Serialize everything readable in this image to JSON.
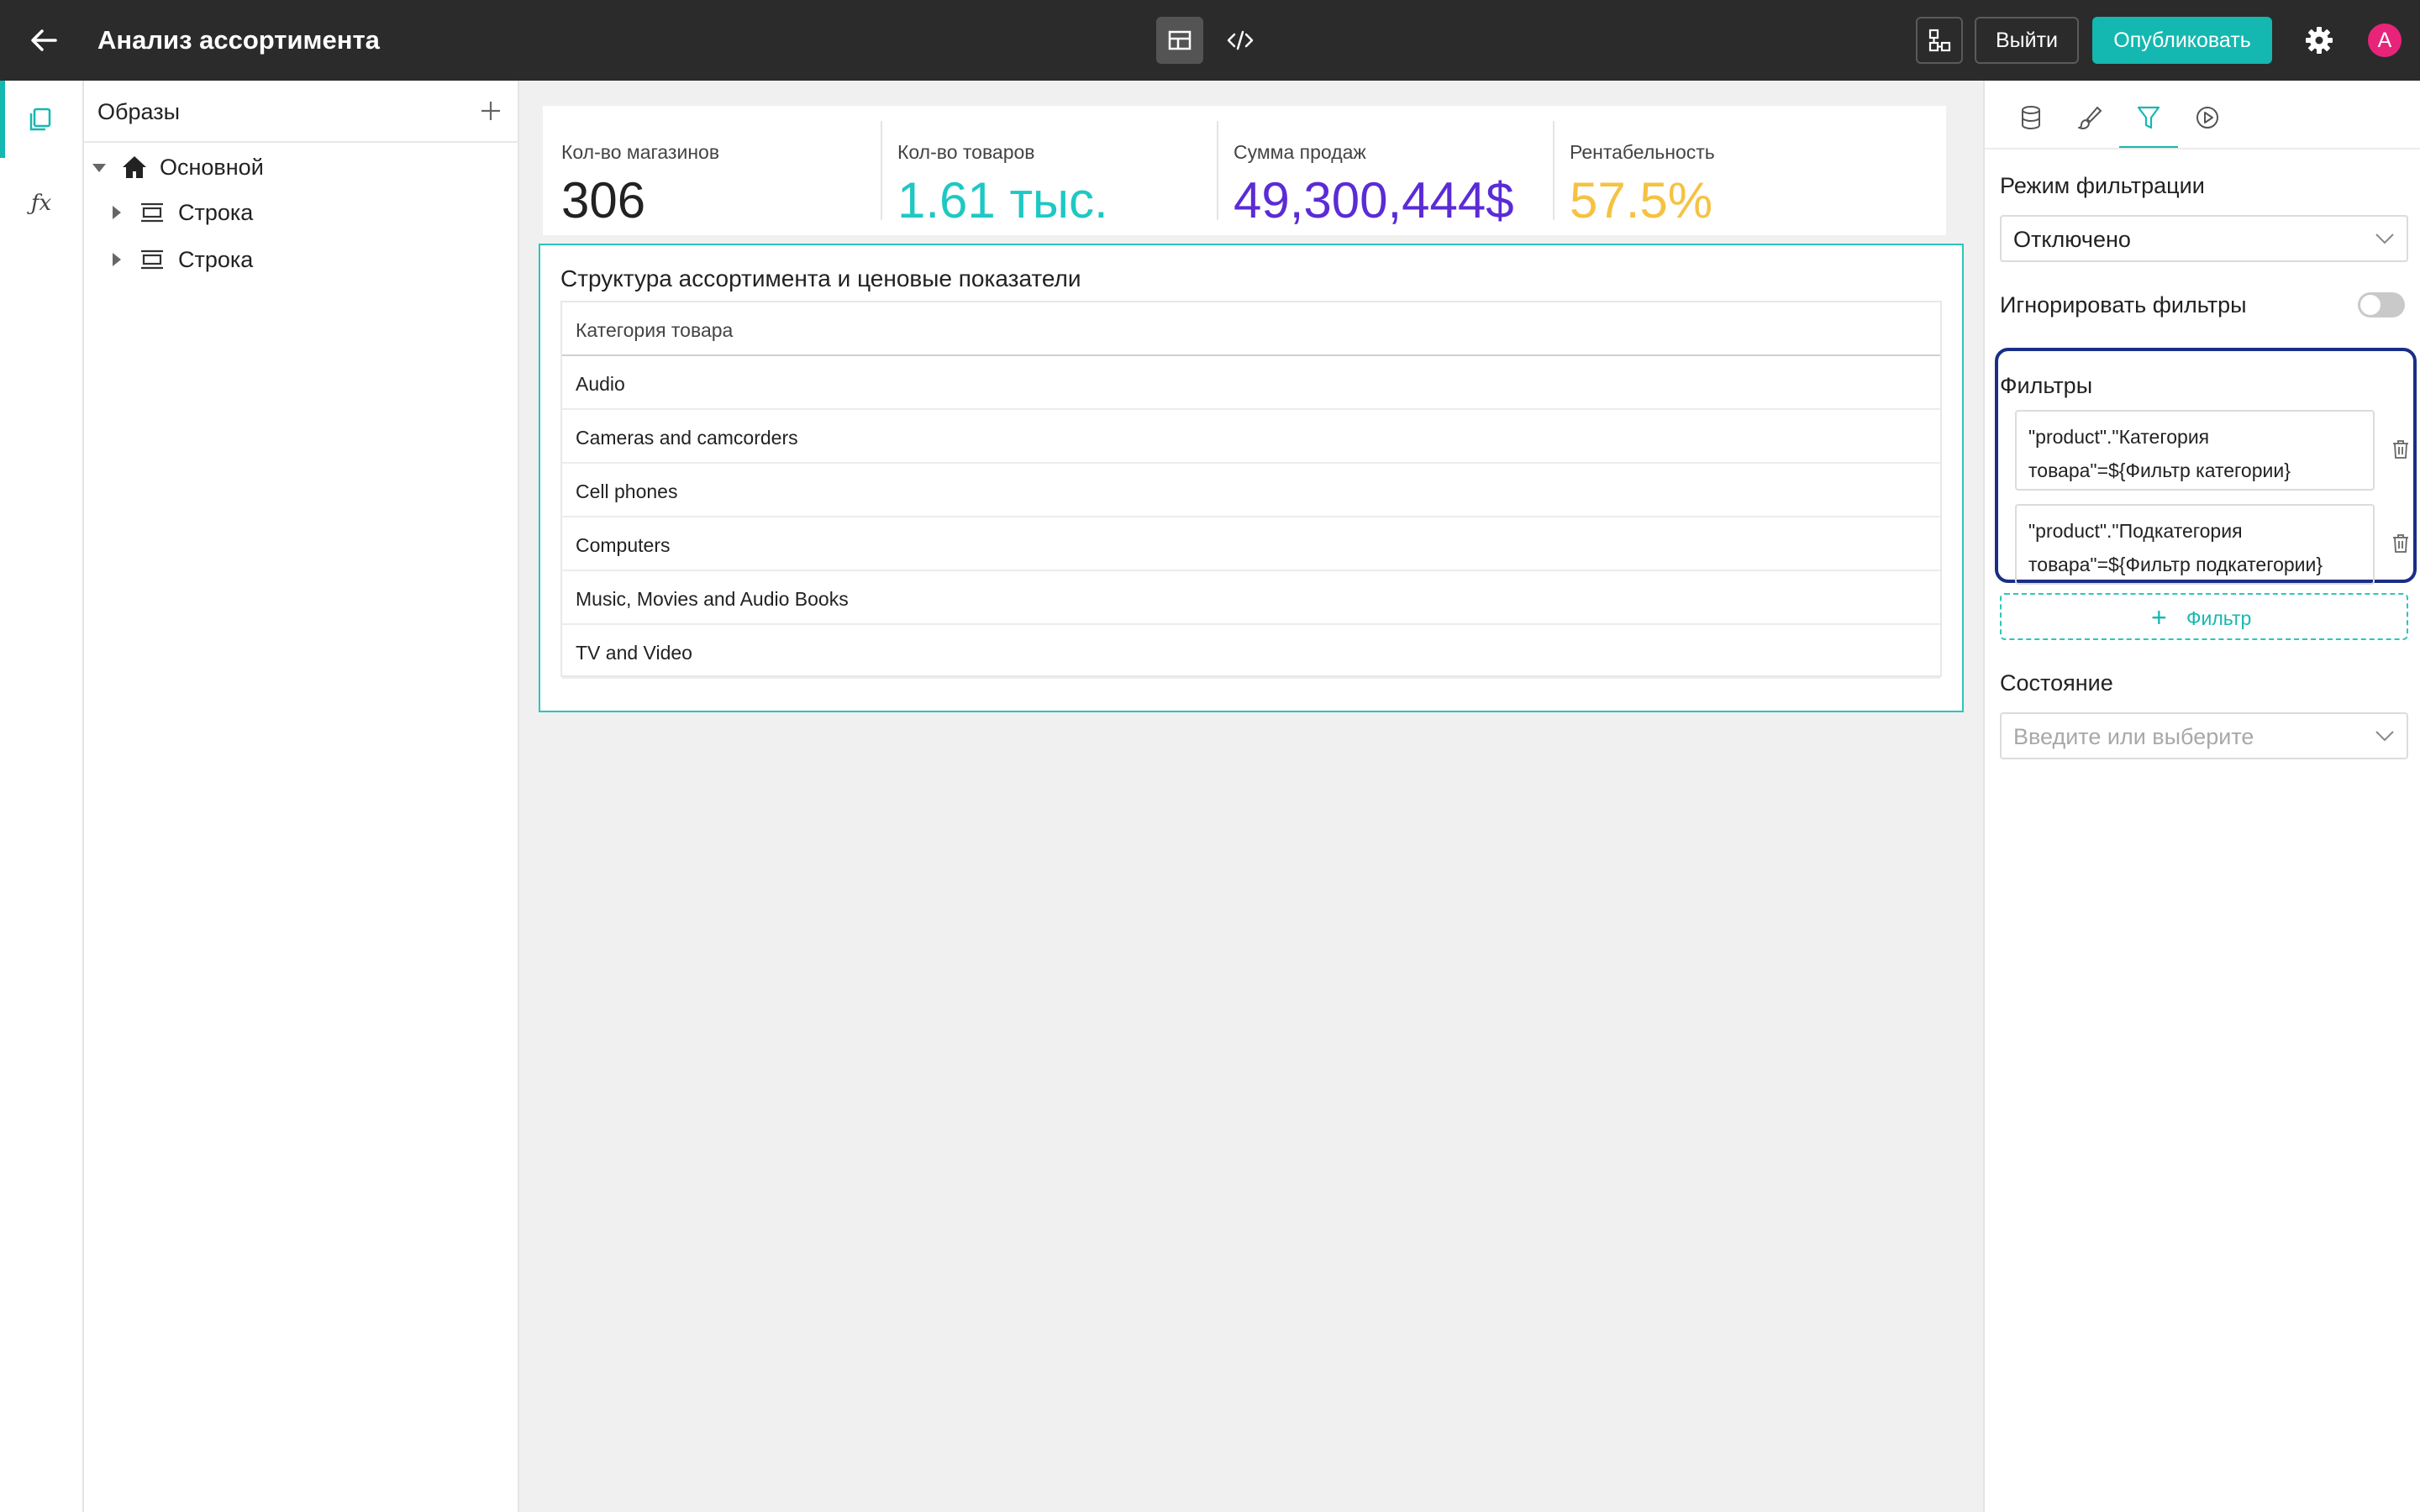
{
  "app": {
    "title": "Анализ ассортимента"
  },
  "toolbar": {
    "exit_label": "Выйти",
    "publish_label": "Опубликовать",
    "avatar_initial": "A",
    "accent_color": "#14b8b0"
  },
  "rail": {
    "fx_label": "ƒx"
  },
  "tree": {
    "title": "Образы",
    "root": "Основной",
    "rows": [
      "Строка",
      "Строка"
    ]
  },
  "kpis": [
    {
      "label": "Кол-во магазинов",
      "value": "306",
      "color": "#222222"
    },
    {
      "label": "Кол-во товаров",
      "value": "1.61 тыс.",
      "color": "#1ec8c3"
    },
    {
      "label": "Сумма продаж",
      "value": "49,300,444$",
      "color": "#5b2bd6"
    },
    {
      "label": "Рентабельность",
      "value": "57.5%",
      "color": "#f5c242"
    }
  ],
  "widget": {
    "title": "Структура ассортимента и ценовые показатели",
    "column_header": "Категория товара",
    "rows": [
      "Audio",
      "Cameras and camcorders",
      "Cell phones",
      "Computers",
      "Music, Movies and Audio Books",
      "TV and Video"
    ]
  },
  "panel": {
    "filter_mode_label": "Режим фильтрации",
    "filter_mode_value": "Отключено",
    "ignore_filters_label": "Игнорировать фильтры",
    "filters_label": "Фильтры",
    "filters": [
      "\"product\".\"Категория товара\"=${Фильтр категории}",
      "\"product\".\"Подкатегория товара\"=${Фильтр подкатегории}"
    ],
    "add_filter_label": "Фильтр",
    "state_label": "Состояние",
    "state_placeholder": "Введите или выберите"
  }
}
